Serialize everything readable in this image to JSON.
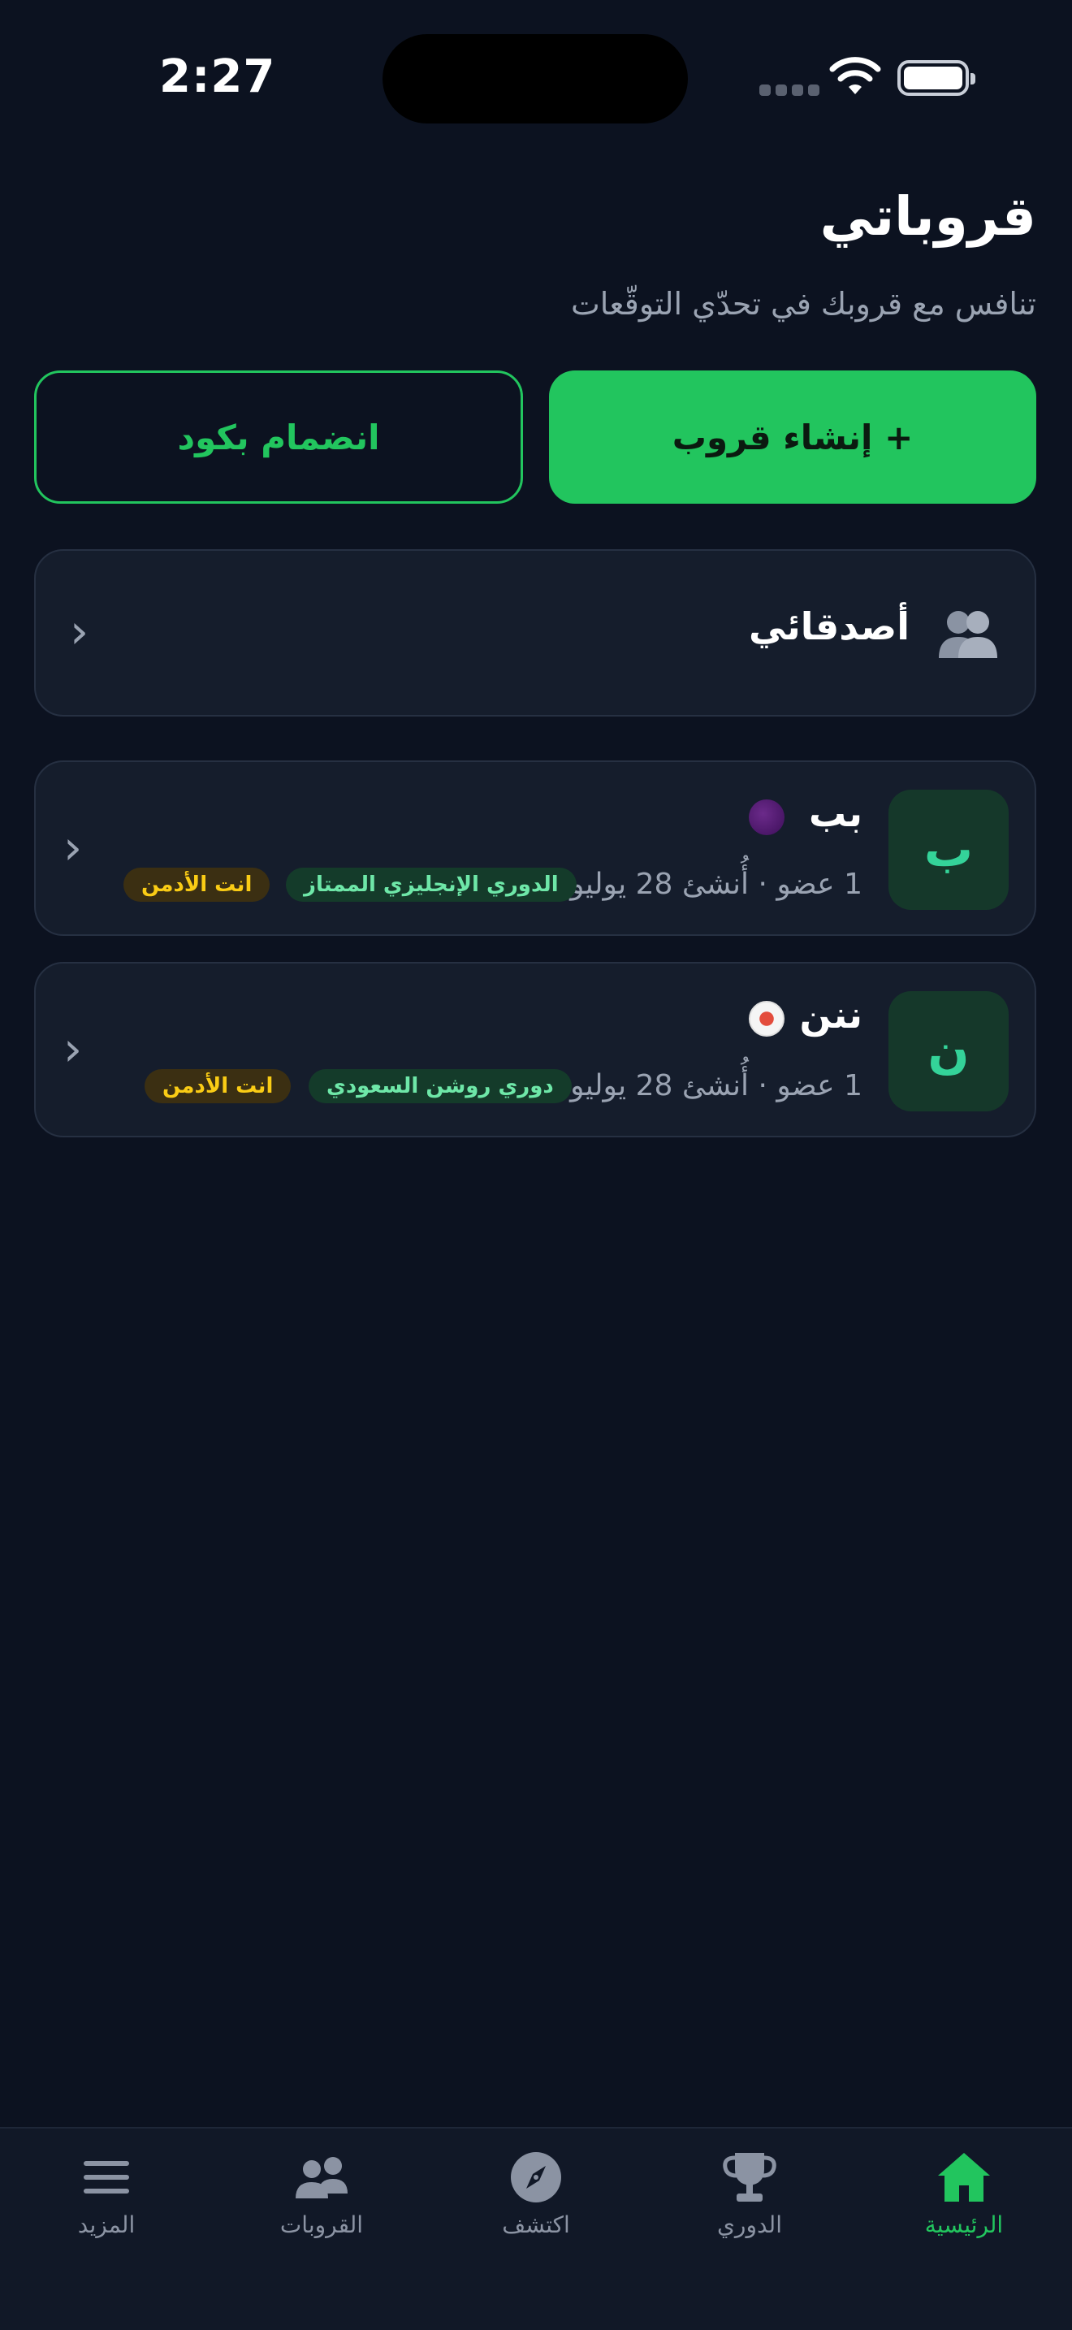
{
  "status_bar": {
    "time": "2:27"
  },
  "header": {
    "title": "قروباتي",
    "subtitle": "تنافس مع قروبك في تحدّي التوقّعات"
  },
  "actions": {
    "create_label": "+ إنشاء قروب",
    "join_label": "انضمام بكود"
  },
  "friends": {
    "label": "أصدقائي",
    "icon": "friends-icon"
  },
  "groups": [
    {
      "initial": "ب",
      "name": "بب",
      "league_icon": "premier-league-icon",
      "meta": "1 عضو · أُنشئ 28 يوليو",
      "league_tag": "الدوري الإنجليزي الممتاز",
      "admin_tag": "انت الأدمن"
    },
    {
      "initial": "ن",
      "name": "ننن",
      "league_icon": "roshn-league-icon",
      "meta": "1 عضو · أُنشئ 28 يوليو",
      "league_tag": "دوري روشن السعودي",
      "admin_tag": "انت الأدمن"
    }
  ],
  "tab_bar": {
    "items": [
      {
        "label": "الرئيسية",
        "icon": "home-icon",
        "active": true
      },
      {
        "label": "الدوري",
        "icon": "trophy-icon",
        "active": false
      },
      {
        "label": "اكتشف",
        "icon": "compass-icon",
        "active": false
      },
      {
        "label": "القروبات",
        "icon": "people-icon",
        "active": false
      },
      {
        "label": "المزيد",
        "icon": "menu-icon",
        "active": false
      }
    ]
  },
  "colors": {
    "background": "#0c1220",
    "accent": "#22c55e",
    "card": "#151d2c",
    "admin_tag": "#facc15"
  }
}
